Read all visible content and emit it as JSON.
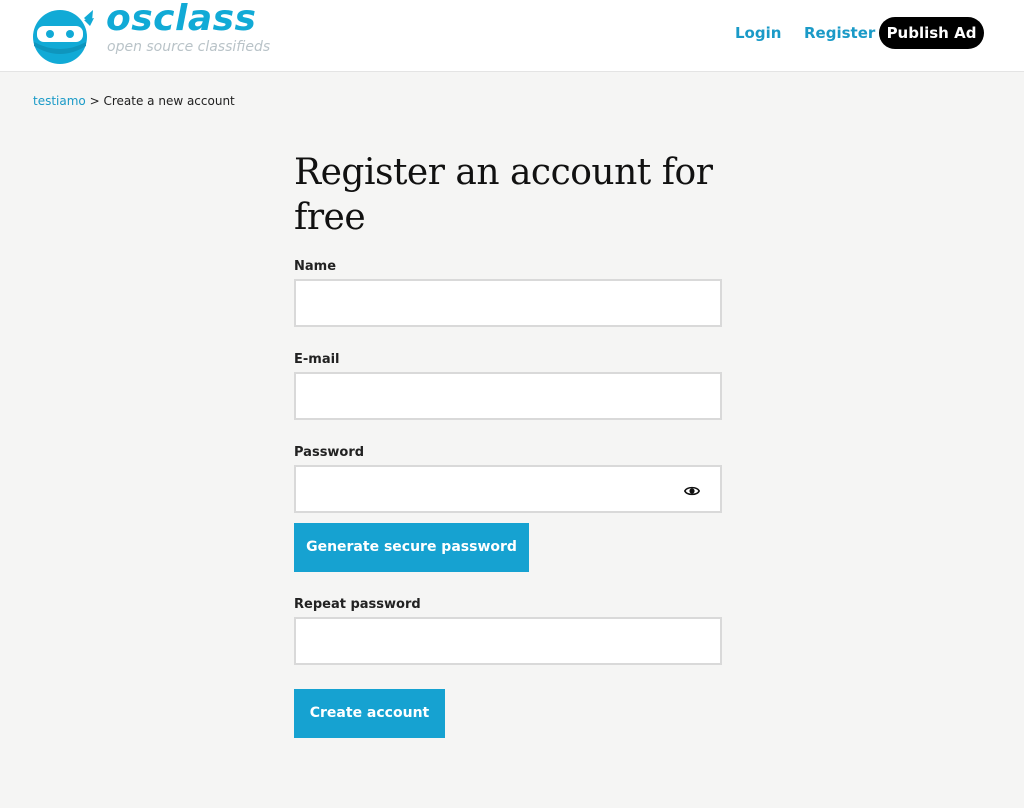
{
  "header": {
    "logo": {
      "wordmark": "osclass",
      "tagline": "open source classifieds"
    },
    "nav": {
      "login_label": "Login",
      "register_label": "Register",
      "publish_label": "Publish Ad"
    }
  },
  "breadcrumb": {
    "root_label": "testiamo",
    "separator": ">",
    "current_label": "Create a new account"
  },
  "form": {
    "title": "Register an account for free",
    "name": {
      "label": "Name",
      "value": ""
    },
    "email": {
      "label": "E-mail",
      "value": ""
    },
    "password": {
      "label": "Password",
      "value": "",
      "toggle_icon": "eye-icon"
    },
    "generate_password_label": "Generate secure password",
    "repeat_password": {
      "label": "Repeat password",
      "value": ""
    },
    "submit_label": "Create account"
  },
  "colors": {
    "accent": "#16a2d1",
    "link": "#1a9ac7",
    "background": "#f5f5f4",
    "publish_button": "#000000"
  }
}
